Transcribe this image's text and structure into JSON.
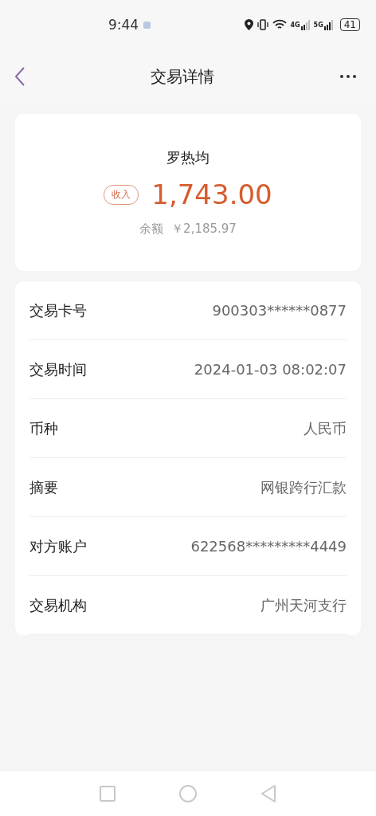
{
  "status_bar": {
    "time": "9:44",
    "network_1": "4G",
    "network_2": "5G",
    "battery": "41"
  },
  "header": {
    "title": "交易详情"
  },
  "summary": {
    "name": "罗热均",
    "tag": "收入",
    "amount": "1,743.00",
    "balance_label": "余额",
    "balance": "￥2,185.97"
  },
  "details": [
    {
      "label": "交易卡号",
      "value": "900303******0877"
    },
    {
      "label": "交易时间",
      "value": "2024-01-03 08:02:07"
    },
    {
      "label": "币种",
      "value": "人民币"
    },
    {
      "label": "摘要",
      "value": "网银跨行汇款"
    },
    {
      "label": "对方账户",
      "value": "622568*********4449"
    },
    {
      "label": "交易机构",
      "value": "广州天河支行"
    }
  ]
}
